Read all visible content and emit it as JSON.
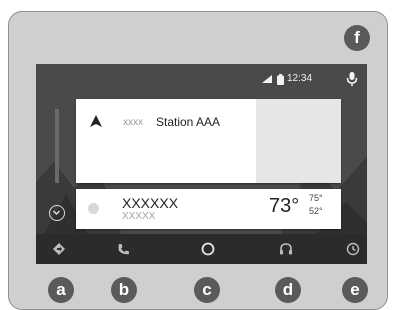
{
  "status_bar": {
    "time": "12:34"
  },
  "navigation_card": {
    "prefix": "xxxx",
    "destination": "Station AAA"
  },
  "weather_card": {
    "location": "XXXXXX",
    "sublabel": "XXXXX",
    "temperature": "73°",
    "high": "75°",
    "low": "52°"
  },
  "bottom_nav": {
    "items": [
      {
        "icon": "navigation-icon"
      },
      {
        "icon": "phone-icon"
      },
      {
        "icon": "home-icon"
      },
      {
        "icon": "headphones-icon"
      },
      {
        "icon": "exit-icon"
      }
    ]
  },
  "callouts": [
    "a",
    "b",
    "c",
    "d",
    "e",
    "f"
  ],
  "colors": {
    "bezel": "#cfcfcf",
    "screen_bg": "#4d4d4d",
    "nav_bar": "#2b2b2b",
    "callout_badge": "#5a5a5a"
  }
}
